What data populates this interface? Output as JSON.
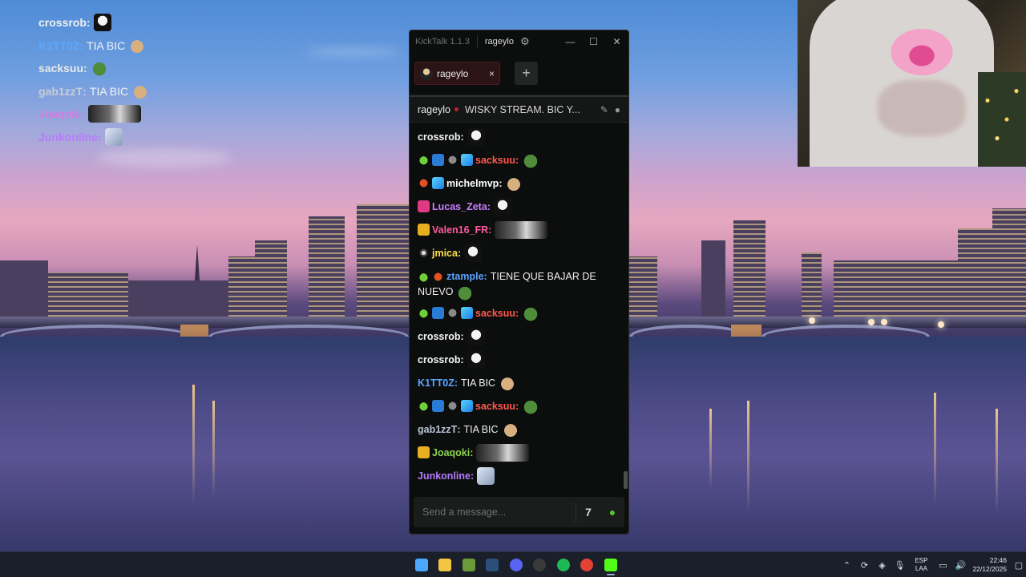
{
  "overlay_chat": [
    {
      "user": "crossrob",
      "color": "#f1f1f1",
      "text": "",
      "emote": "bw"
    },
    {
      "user": "K1TT0Z",
      "color": "#5aa8ff",
      "text": "TIA BIC",
      "emote": "dog"
    },
    {
      "user": "sacksuu",
      "color": "#e8e8e8",
      "text": "",
      "emote": "frog"
    },
    {
      "user": "gab1zzT",
      "color": "#c8ccd8",
      "text": "TIA BIC",
      "emote": "dog"
    },
    {
      "user": "Joaqoki",
      "color": "#d77ae0",
      "text": "",
      "emote": "wide"
    },
    {
      "user": "Junkonline",
      "color": "#b67bff",
      "text": "",
      "emote": "ice"
    }
  ],
  "window": {
    "app_title": "KickTalk 1.1.3",
    "user": "rageylo",
    "minimize": "—",
    "maximize": "☐",
    "close": "✕"
  },
  "tabs": [
    {
      "label": "rageylo",
      "close": "×"
    }
  ],
  "add_tab": "+",
  "channel": {
    "name": "rageylo",
    "title": "WISKY STREAM. BIC Y..."
  },
  "messages": [
    {
      "user": "crossrob",
      "color": "#f5f5f5",
      "badges": [],
      "text": "",
      "emote": "bw"
    },
    {
      "user": "sacksuu",
      "color": "#ff5a4f",
      "badges": [
        "bot",
        "mod",
        "gray",
        "cube"
      ],
      "text": "",
      "emote": "frog"
    },
    {
      "user": "michelmvp",
      "color": "#ffffff",
      "badges": [
        "red",
        "cube"
      ],
      "text": "",
      "emote": "dog"
    },
    {
      "user": "Lucas_Zeta",
      "color": "#c77dff",
      "badges": [
        "pink"
      ],
      "text": "",
      "emote": "bw"
    },
    {
      "user": "Valen16_FR",
      "color": "#ff5aa0",
      "badges": [
        "gold"
      ],
      "text": "",
      "emote": "wide"
    },
    {
      "user": "jmica",
      "color": "#ffe14b",
      "badges": [
        "ring"
      ],
      "text": "",
      "emote": "bw"
    },
    {
      "user": "ztample",
      "color": "#5aa0ff",
      "badges": [
        "bot",
        "red"
      ],
      "text": "TIENE QUE BAJAR DE NUEVO",
      "emote": "frog"
    },
    {
      "user": "sacksuu",
      "color": "#ff5a4f",
      "badges": [
        "bot",
        "mod",
        "gray",
        "cube"
      ],
      "text": "",
      "emote": "frog"
    },
    {
      "user": "crossrob",
      "color": "#f5f5f5",
      "badges": [],
      "text": "",
      "emote": "bw"
    },
    {
      "user": "crossrob",
      "color": "#f5f5f5",
      "badges": [],
      "text": "",
      "emote": "bw"
    },
    {
      "user": "K1TT0Z",
      "color": "#5aa8ff",
      "badges": [],
      "text": "TIA BIC",
      "emote": "dog"
    },
    {
      "user": "sacksuu",
      "color": "#ff5a4f",
      "badges": [
        "bot",
        "mod",
        "gray",
        "cube"
      ],
      "text": "",
      "emote": "frog"
    },
    {
      "user": "gab1zzT",
      "color": "#b9c3d6",
      "badges": [],
      "text": "TIA BIC",
      "emote": "dog"
    },
    {
      "user": "Joaqoki",
      "color": "#8bd34e",
      "badges": [
        "gold"
      ],
      "text": "",
      "emote": "wide"
    },
    {
      "user": "Junkonline",
      "color": "#b67bff",
      "badges": [],
      "text": "",
      "emote": "ice"
    }
  ],
  "input": {
    "placeholder": "Send a message..."
  },
  "taskbar": {
    "apps": [
      {
        "name": "windows-start",
        "color": "#4aa8ff"
      },
      {
        "name": "file-explorer",
        "color": "#f4c443"
      },
      {
        "name": "minecraft",
        "color": "#6b9a3a"
      },
      {
        "name": "steam",
        "color": "#2c4f7a"
      },
      {
        "name": "discord",
        "color": "#5865f2"
      },
      {
        "name": "obs",
        "color": "#3a3a3a"
      },
      {
        "name": "spotify",
        "color": "#1db954"
      },
      {
        "name": "chrome",
        "color": "#e34133"
      },
      {
        "name": "kicktalk",
        "color": "#53fc18"
      }
    ],
    "lang_top": "ESP",
    "lang_bottom": "LAA",
    "time": "22:46",
    "date": "22/12/2025"
  }
}
